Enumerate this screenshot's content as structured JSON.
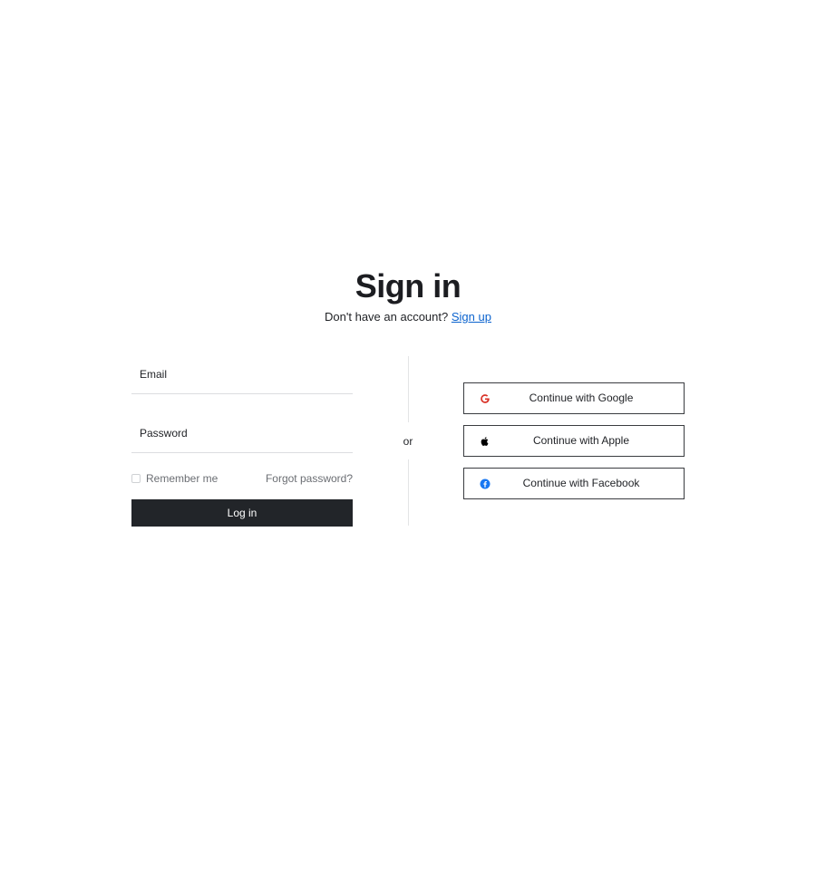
{
  "heading": {
    "title": "Sign in",
    "subtitle_text": "Don't have an account?",
    "signup_link": "Sign up"
  },
  "form": {
    "email_placeholder": "Email",
    "password_placeholder": "Password",
    "remember_label": "Remember me",
    "remember_checked": false,
    "forgot_label": "Forgot password?",
    "login_label": "Log in"
  },
  "divider": {
    "label": "or"
  },
  "social": [
    {
      "label": "Continue with Google",
      "icon": "google-icon",
      "color": "#d93025"
    },
    {
      "label": "Continue with Apple",
      "icon": "apple-icon",
      "color": "#000000"
    },
    {
      "label": "Continue with Facebook",
      "icon": "facebook-icon",
      "color": "#1877f2"
    }
  ],
  "colors": {
    "primary_button": "#222529",
    "link": "#0b63ce",
    "text": "#1f2125",
    "muted": "#6b6e73"
  }
}
